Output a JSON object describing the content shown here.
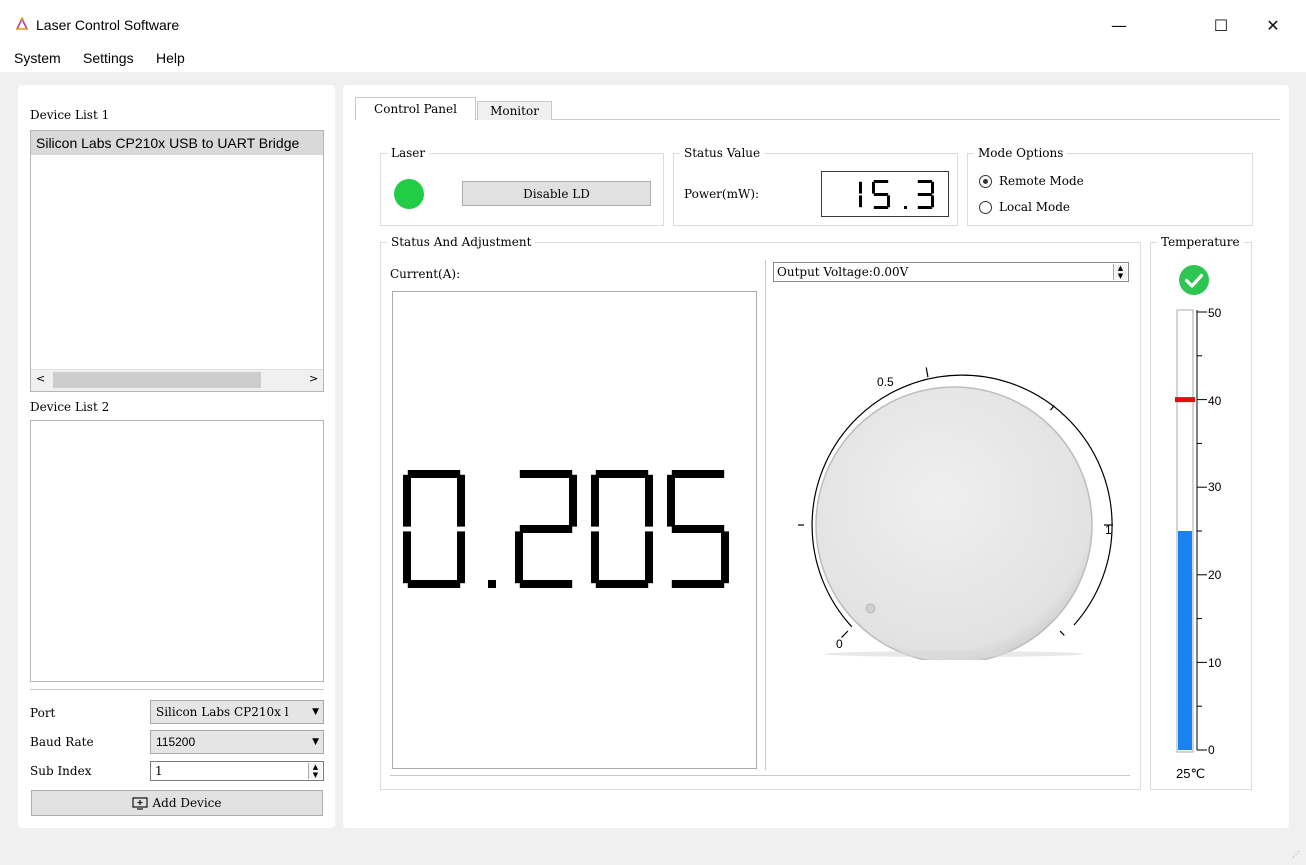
{
  "window": {
    "title": "Laser Control Software",
    "minimize": "—",
    "maximize": "☐",
    "close": "✕"
  },
  "menu": [
    "System",
    "Settings",
    "Help"
  ],
  "sidebar": {
    "device_list_1_label": "Device List 1",
    "device_list_1_items": [
      "Silicon Labs CP210x USB to UART Bridge"
    ],
    "device_list_2_label": "Device List 2",
    "port_label": "Port",
    "port_value": "Silicon Labs CP210x l",
    "baud_label": "Baud Rate",
    "baud_value": "115200",
    "sub_index_label": "Sub Index",
    "sub_index_value": "1",
    "add_device_label": "Add Device"
  },
  "tabs": [
    "Control Panel",
    "Monitor"
  ],
  "laser": {
    "group_title": "Laser",
    "indicator_color": "#22cc44",
    "button_label": "Disable LD"
  },
  "status_value": {
    "group_title": "Status Value",
    "power_label": "Power(mW):",
    "power_value": "15.31"
  },
  "mode_options": {
    "group_title": "Mode Options",
    "options": [
      "Remote Mode",
      "Local Mode"
    ],
    "selected": "Remote Mode"
  },
  "adjustment": {
    "group_title": "Status And Adjustment",
    "current_label": "Current(A):",
    "current_value": "0.205",
    "output_voltage": "Output Voltage:0.00V",
    "dial_labels": [
      "0",
      "0.5",
      "1"
    ],
    "dial_value": 0
  },
  "temperature": {
    "group_title": "Temperature",
    "status_icon": "check-circle-icon",
    "status_color": "#2dc653",
    "scale_labels": [
      "50",
      "40",
      "30",
      "20",
      "10",
      "0"
    ],
    "value": 25,
    "threshold": 40,
    "readout": "25℃",
    "fill_color": "#1a82f0",
    "threshold_color": "#e01010"
  }
}
